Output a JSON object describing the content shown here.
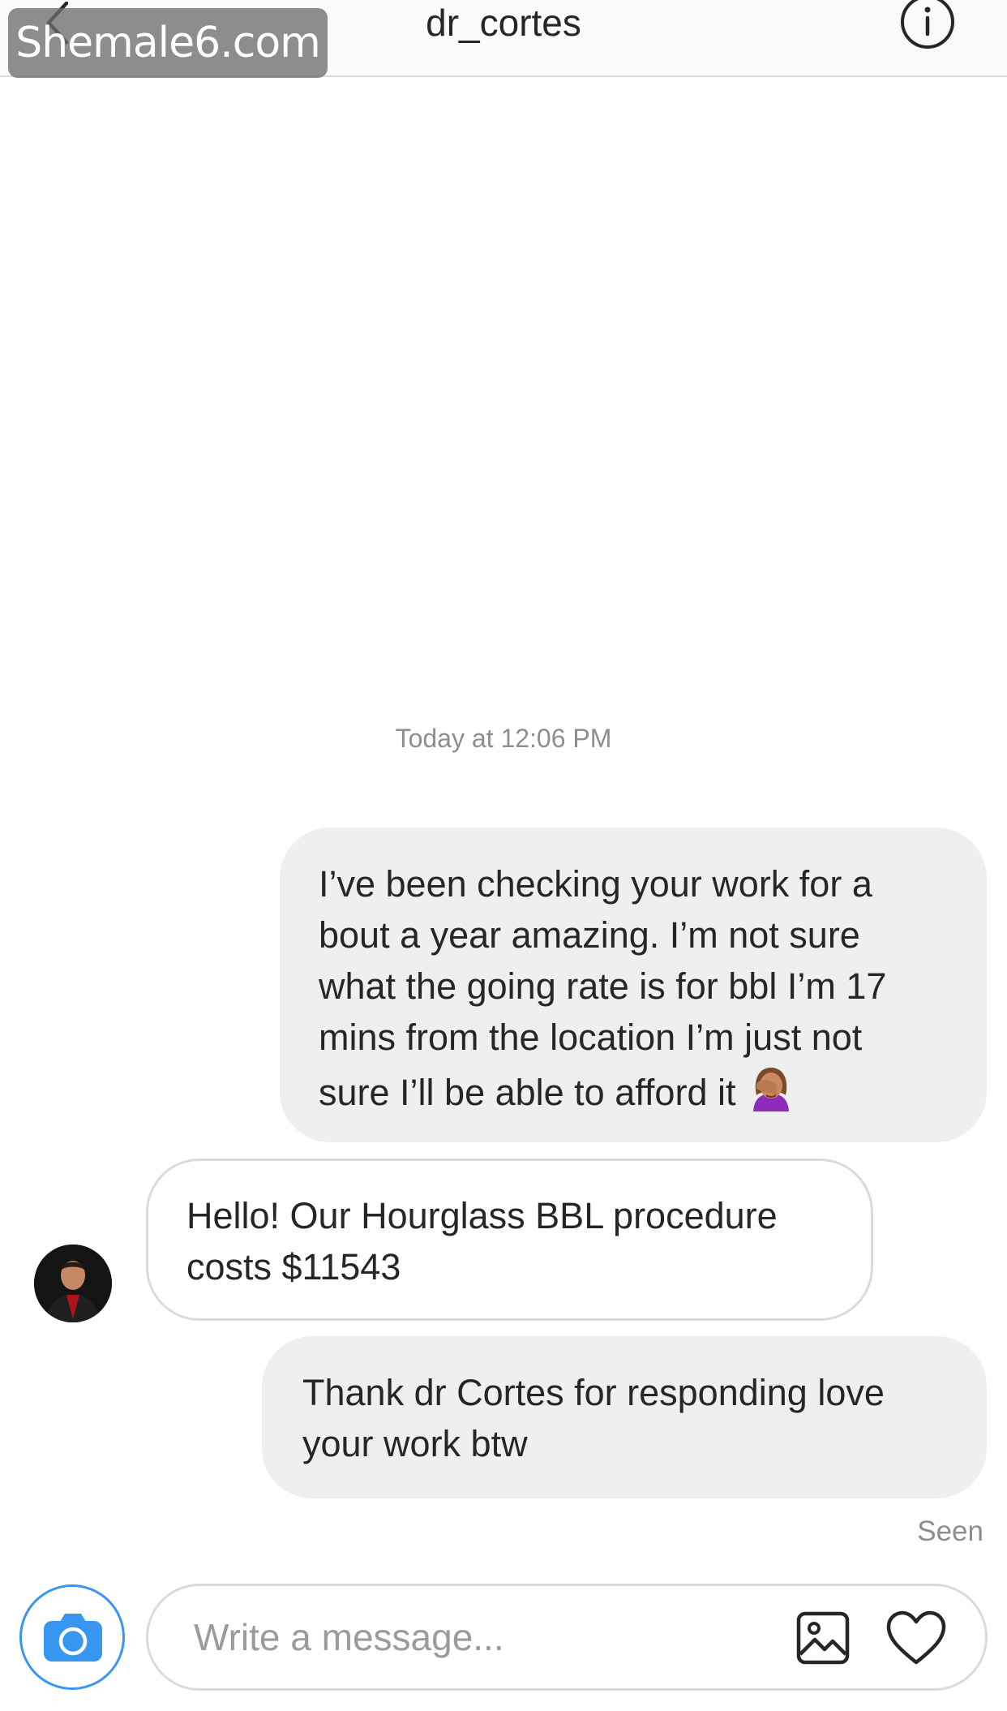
{
  "watermark": "Shemale6.com",
  "header": {
    "title": "dr_cortes",
    "back_icon": "chevron-left-icon",
    "info_icon": "info-icon"
  },
  "conversation": {
    "timestamp": "Today at 12:06 PM",
    "messages": [
      {
        "direction": "outgoing",
        "lines": [
          "I’ve been checking your work for a",
          "bout a year amazing. I’m not sure",
          "what the going rate is for bbl I’m 17",
          "mins from the location I’m just not",
          "sure I’ll be able to afford it"
        ],
        "emoji": "facepalm-emoji"
      },
      {
        "direction": "incoming",
        "lines": [
          "Hello! Our Hourglass BBL procedure",
          "costs $11543"
        ]
      },
      {
        "direction": "outgoing",
        "lines": [
          "Thank dr Cortes for responding love",
          "your work btw"
        ]
      }
    ],
    "seen_label": "Seen"
  },
  "composer": {
    "placeholder": "Write a message...",
    "camera_icon": "camera-icon",
    "gallery_icon": "image-gallery-icon",
    "heart_icon": "heart-icon"
  },
  "colors": {
    "accent": "#3797f0",
    "outgoing_bubble": "#efefef",
    "incoming_border": "#dbdbdb",
    "secondary_text": "#8e8e8e"
  }
}
